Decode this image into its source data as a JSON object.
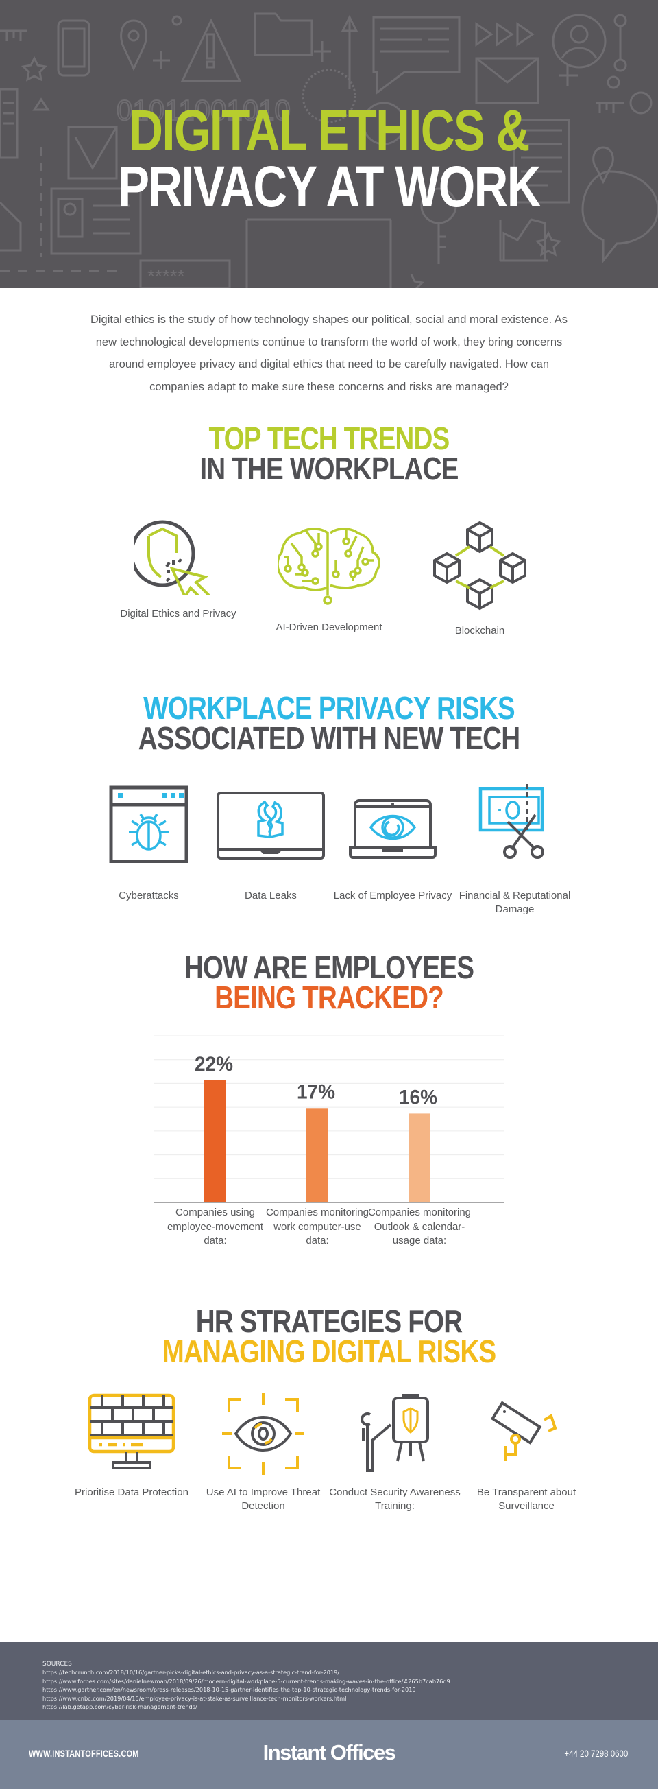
{
  "hero": {
    "title_line1": "DIGITAL ETHICS &",
    "title_line2": "PRIVACY AT WORK",
    "accent_color": "#b7cd2e",
    "background_color": "#58565a"
  },
  "intro": {
    "text": "Digital ethics is the study of how technology shapes our political, social and moral existence. As new technological developments continue to transform the world of work, they bring concerns around employee privacy and digital ethics that need to be carefully navigated. How can companies adapt to make sure these concerns and risks are managed?"
  },
  "trends": {
    "title_line1": "TOP TECH TRENDS",
    "title_line2": "IN THE WORKPLACE",
    "items": [
      {
        "icon": "shield-cursor-icon",
        "label": "Digital Ethics and Privacy"
      },
      {
        "icon": "circuit-brain-icon",
        "label": "AI-Driven Development"
      },
      {
        "icon": "blockchain-icon",
        "label": "Blockchain"
      }
    ]
  },
  "risks": {
    "title_line1": "WORKPLACE PRIVACY RISKS",
    "title_line2": "ASSOCIATED WITH NEW TECH",
    "items": [
      {
        "icon": "browser-bug-icon",
        "label": "Cyberattacks"
      },
      {
        "icon": "laptop-broken-lock-icon",
        "label": "Data Leaks"
      },
      {
        "icon": "laptop-eye-icon",
        "label": "Lack of Employee Privacy"
      },
      {
        "icon": "cut-banknote-icon",
        "label": "Financial & Reputational Damage"
      }
    ]
  },
  "tracking": {
    "title_line1": "HOW ARE EMPLOYEES",
    "title_line2": "BEING TRACKED?"
  },
  "chart_data": {
    "type": "bar",
    "title": "HOW ARE EMPLOYEES BEING TRACKED?",
    "categories": [
      "Companies using employee-movement data:",
      "Companies monitoring work computer-use data:",
      "Companies monitoring Outlook & calendar-usage data:"
    ],
    "values": [
      22,
      17,
      16
    ],
    "value_labels": [
      "22%",
      "17%",
      "16%"
    ],
    "colors": [
      "#e86226",
      "#f0894a",
      "#f5b585"
    ],
    "unit": "%",
    "xlabel": "",
    "ylabel": "",
    "ylim": [
      0,
      30
    ],
    "grid": true,
    "gridline_count": 7,
    "legend": "none"
  },
  "strategies": {
    "title_line1": "HR STRATEGIES FOR",
    "title_line2": "MANAGING DIGITAL RISKS",
    "items": [
      {
        "icon": "firewall-monitor-icon",
        "label": "Prioritise Data Protection"
      },
      {
        "icon": "eye-target-icon",
        "label": "Use AI to Improve Threat Detection"
      },
      {
        "icon": "presenter-board-icon",
        "label": "Conduct Security Awareness Training:"
      },
      {
        "icon": "cctv-camera-icon",
        "label": "Be Transparent about Surveillance"
      }
    ]
  },
  "sources": {
    "title": "SOURCES",
    "items": [
      "https://techcrunch.com/2018/10/16/gartner-picks-digital-ethics-and-privacy-as-a-strategic-trend-for-2019/",
      "https://www.forbes.com/sites/danielnewman/2018/09/26/modern-digital-workplace-5-current-trends-making-waves-in-the-office/#265b7cab76d9",
      "https://www.gartner.com/en/newsroom/press-releases/2018-10-15-gartner-identifies-the-top-10-strategic-technology-trends-for-2019",
      "https://www.cnbc.com/2019/04/15/employee-privacy-is-at-stake-as-surveillance-tech-monitors-workers.html",
      "https://lab.getapp.com/cyber-risk-management-trends/"
    ]
  },
  "footer": {
    "website": "WWW.INSTANTOFFICES.COM",
    "brand": "Instant Offices",
    "phone": "+44 20 7298 0600"
  }
}
